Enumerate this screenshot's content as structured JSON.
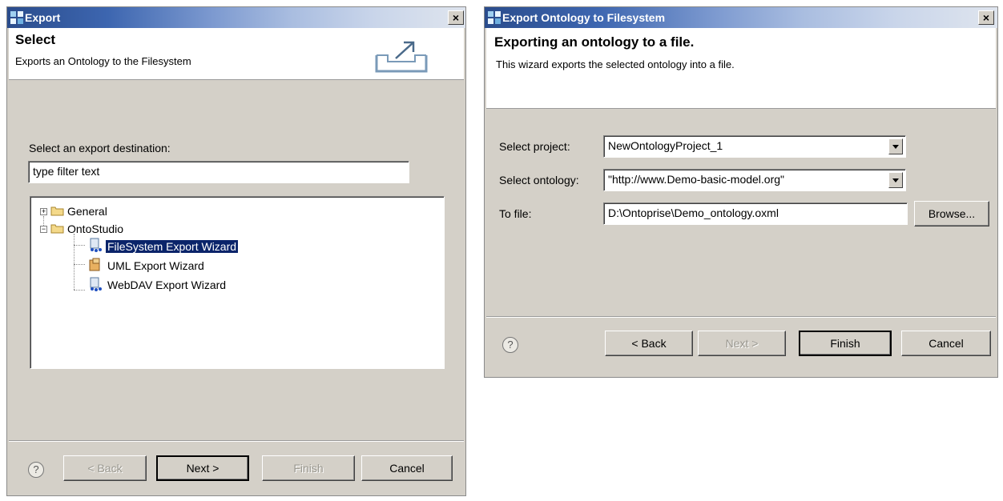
{
  "export_dialog": {
    "title": "Export",
    "close_label": "×",
    "header_title": "Select",
    "header_description": "Exports an Ontology to the Filesystem",
    "destination_label": "Select an export destination:",
    "filter_value": "type filter text",
    "tree": {
      "general": "General",
      "ontostudio": "OntoStudio",
      "items": [
        "FileSystem Export Wizard",
        "UML Export Wizard",
        "WebDAV Export Wizard"
      ],
      "selected_item": "FileSystem Export Wizard"
    },
    "buttons": {
      "help": "?",
      "back": "< Back",
      "next": "Next >",
      "finish": "Finish",
      "cancel": "Cancel"
    }
  },
  "ontology_dialog": {
    "title": "Export Ontology to Filesystem",
    "close_label": "×",
    "header_title": "Exporting an ontology to a file.",
    "header_description": "This wizard exports the selected ontology into a file.",
    "project_label": "Select project:",
    "project_value": "NewOntologyProject_1",
    "ontology_label": "Select ontology:",
    "ontology_value": "\"http://www.Demo-basic-model.org\"",
    "file_label": "To file:",
    "file_value": "D:\\Ontoprise\\Demo_ontology.oxml",
    "browse_label": "Browse...",
    "buttons": {
      "help": "?",
      "back": "< Back",
      "next": "Next >",
      "finish": "Finish",
      "cancel": "Cancel"
    }
  },
  "colors": {
    "selection": "#0a246a",
    "dialog_face": "#d4d0c8",
    "title_start": "#2a4c8c"
  },
  "icons": [
    "window-icon",
    "close-icon",
    "export-icon",
    "folder-icon",
    "wizard-icon",
    "help-icon",
    "dropdown-arrow-icon"
  ]
}
